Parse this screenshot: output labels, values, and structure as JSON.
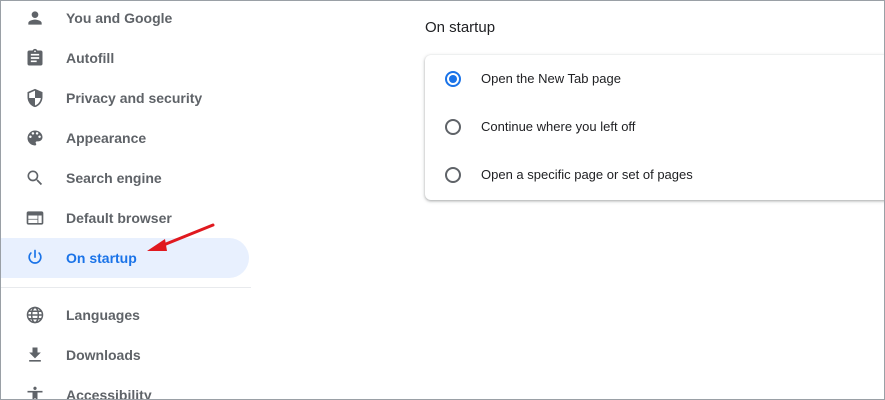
{
  "sidebar": {
    "items": [
      {
        "label": "You and Google",
        "icon": "person-icon"
      },
      {
        "label": "Autofill",
        "icon": "clipboard-icon"
      },
      {
        "label": "Privacy and security",
        "icon": "shield-icon"
      },
      {
        "label": "Appearance",
        "icon": "palette-icon"
      },
      {
        "label": "Search engine",
        "icon": "search-icon"
      },
      {
        "label": "Default browser",
        "icon": "browser-window-icon"
      },
      {
        "label": "On startup",
        "icon": "power-icon",
        "active": true
      },
      {
        "label": "Languages",
        "icon": "globe-icon"
      },
      {
        "label": "Downloads",
        "icon": "download-icon"
      },
      {
        "label": "Accessibility",
        "icon": "accessibility-icon"
      }
    ]
  },
  "main": {
    "section_title": "On startup",
    "options": [
      {
        "label": "Open the New Tab page",
        "checked": true
      },
      {
        "label": "Continue where you left off",
        "checked": false
      },
      {
        "label": "Open a specific page or set of pages",
        "checked": false
      }
    ]
  },
  "colors": {
    "accent": "#1a73e8",
    "active_bg": "#e8f0fe",
    "text_muted": "#5f6368",
    "annotation_arrow": "#e0191f"
  }
}
